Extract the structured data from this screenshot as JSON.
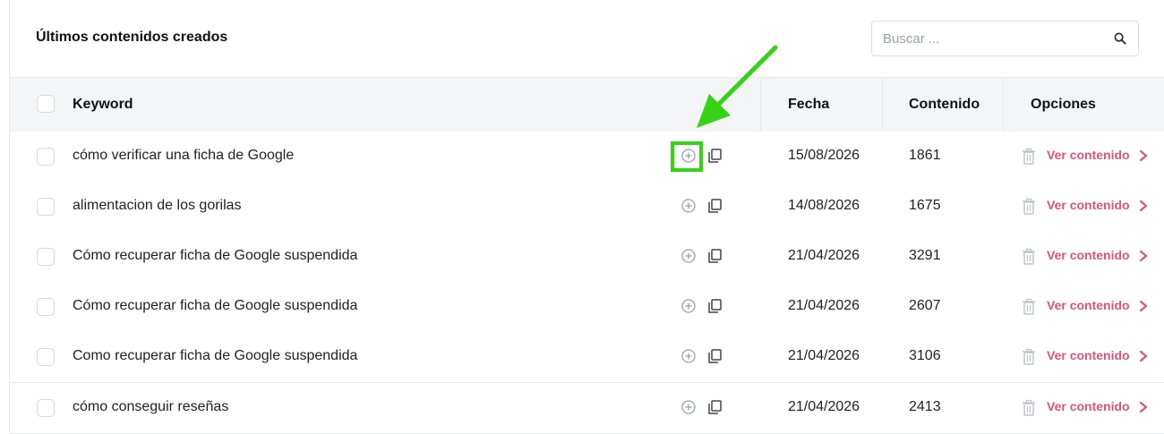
{
  "card": {
    "title": "Últimos contenidos creados"
  },
  "search": {
    "placeholder": "Buscar ...",
    "icon": "search-icon"
  },
  "table": {
    "headers": {
      "keyword": "Keyword",
      "date": "Fecha",
      "content": "Contenido",
      "options": "Opciones"
    },
    "rows": [
      {
        "keyword": "cómo verificar una ficha de Google",
        "date": "15/08/2026",
        "content": "1861",
        "action": "Ver contenido"
      },
      {
        "keyword": "alimentacion de los gorilas",
        "date": "14/08/2026",
        "content": "1675",
        "action": "Ver contenido"
      },
      {
        "keyword": "Cómo recuperar ficha de Google suspendida",
        "date": "21/04/2026",
        "content": "3291",
        "action": "Ver contenido"
      },
      {
        "keyword": "Cómo recuperar ficha de Google suspendida",
        "date": "21/04/2026",
        "content": "2607",
        "action": "Ver contenido"
      },
      {
        "keyword": "Como recuperar ficha de Google suspendida",
        "date": "21/04/2026",
        "content": "3106",
        "action": "Ver contenido"
      },
      {
        "keyword": "cómo conseguir reseñas",
        "date": "21/04/2026",
        "content": "2413",
        "action": "Ver contenido"
      }
    ]
  },
  "colors": {
    "accent": "#e0527a",
    "highlight": "#34d315",
    "header_bg": "#f4f5f7",
    "border": "#e7e9ee"
  },
  "icons": [
    "search-icon",
    "plus-circle-icon",
    "copy-icon",
    "trash-icon",
    "chevron-right-icon",
    "arrow-annotation-icon"
  ]
}
